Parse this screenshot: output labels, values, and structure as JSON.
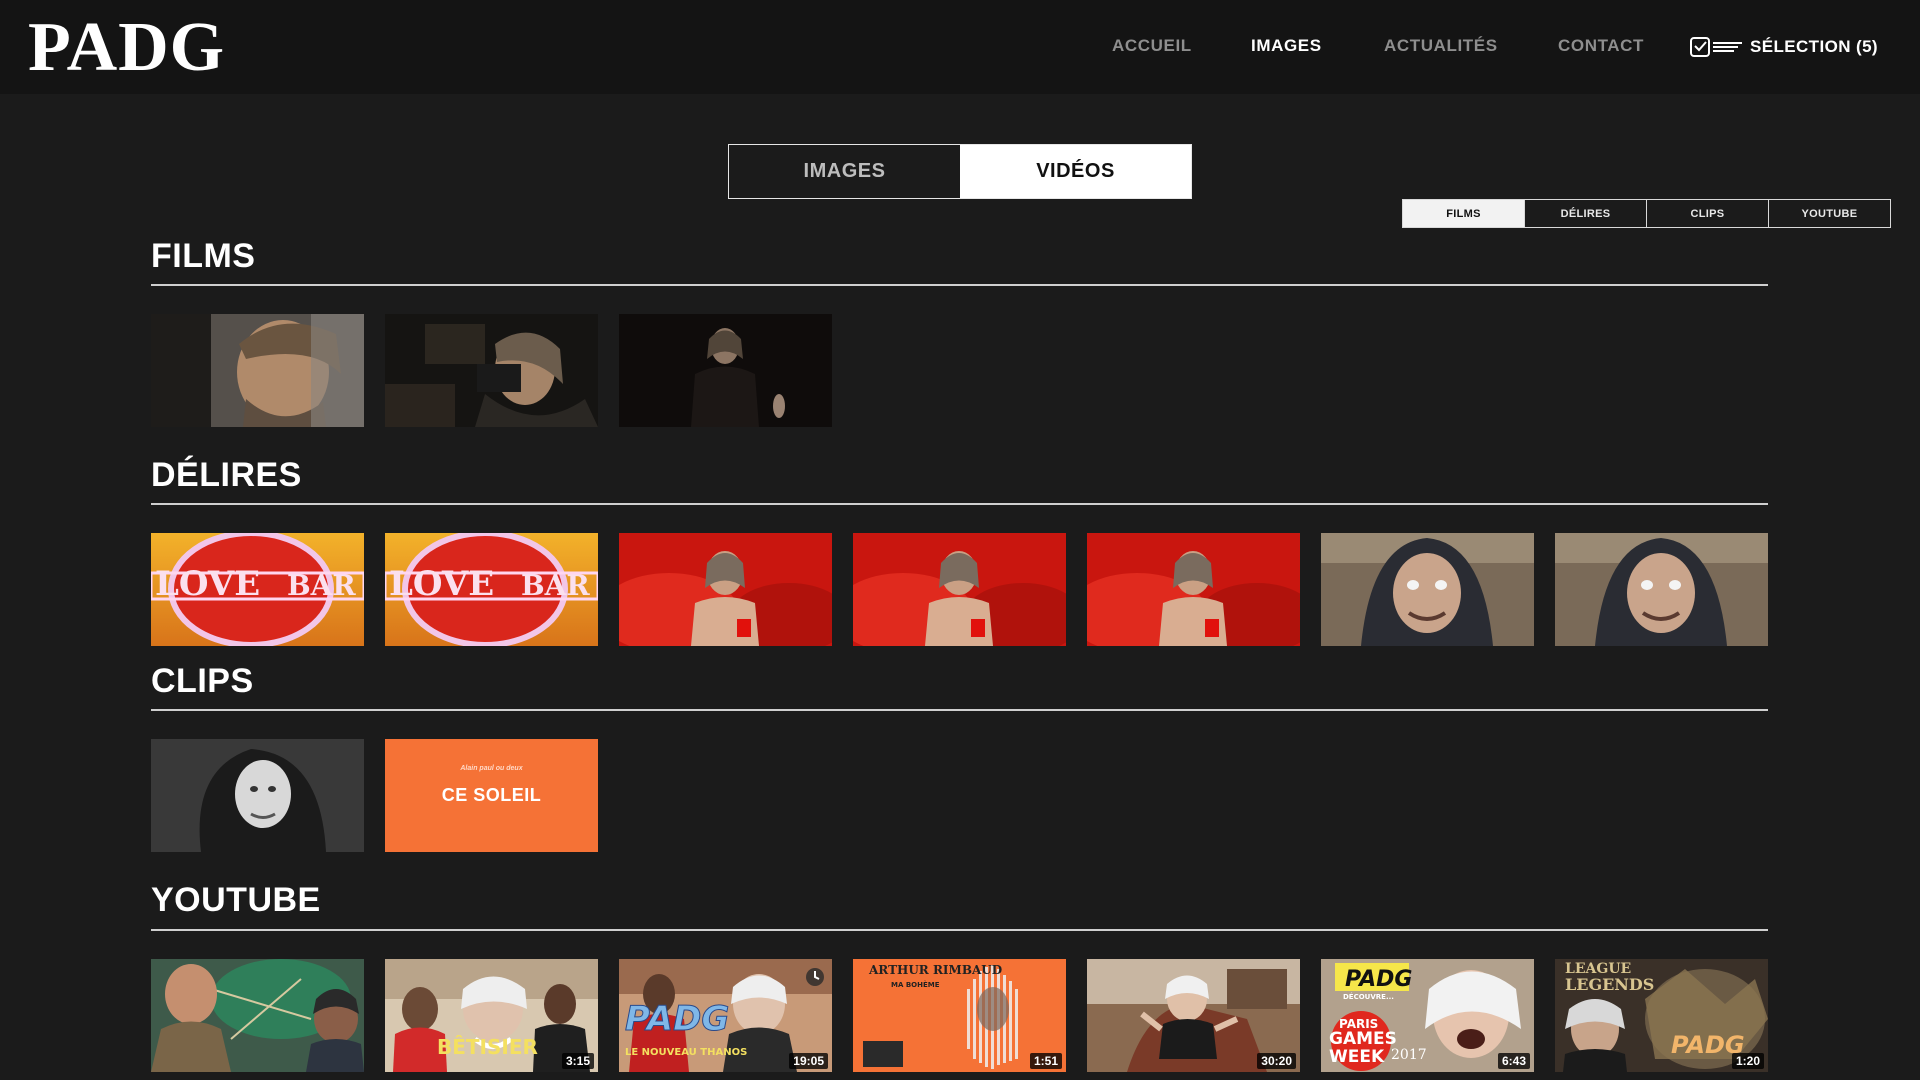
{
  "header": {
    "logo": "PADG",
    "nav": [
      {
        "label": "ACCUEIL",
        "active": false
      },
      {
        "label": "IMAGES",
        "active": true
      },
      {
        "label": "ACTUALITÉS",
        "active": false
      },
      {
        "label": "CONTACT",
        "active": false
      }
    ],
    "selection_label": "SÉLECTION (5)"
  },
  "toggle": {
    "images": "IMAGES",
    "videos": "VIDÉOS",
    "selected": "VIDÉOS"
  },
  "subtabs": {
    "items": [
      "FILMS",
      "DÉLIRES",
      "CLIPS",
      "YOUTUBE"
    ],
    "selected": "FILMS"
  },
  "sections": {
    "films": {
      "title": "FILMS",
      "count": 3
    },
    "delires": {
      "title": "DÉLIRES",
      "count": 7
    },
    "clips": {
      "title": "CLIPS",
      "count": 2,
      "soleil_small": "Alain paul ou deux",
      "soleil_big": "CE SOLEIL"
    },
    "youtube": {
      "title": "YOUTUBE",
      "durations": [
        "",
        "3:15",
        "19:05",
        "1:51",
        "30:20",
        "6:43",
        "1:20"
      ],
      "texts": {
        "betisier": "BÊTISIER",
        "padg": "PADG",
        "nouveau": "LE NOUVEAU THANOS",
        "rimbaud": "ARTHUR RIMBAUD",
        "boheme": "MA BOHÈME",
        "padg2": "PADG",
        "decouvre": "DÉCOUVRE...",
        "paris": "PARIS",
        "games": "GAMES",
        "week": "WEEK",
        "year": "2017",
        "league": "LEAGUE",
        "legends": "LEGENDS",
        "padg3": "PADG"
      }
    }
  },
  "colors": {
    "background": "#1b1b1b",
    "header": "#141414",
    "accent_orange": "#f57236"
  }
}
